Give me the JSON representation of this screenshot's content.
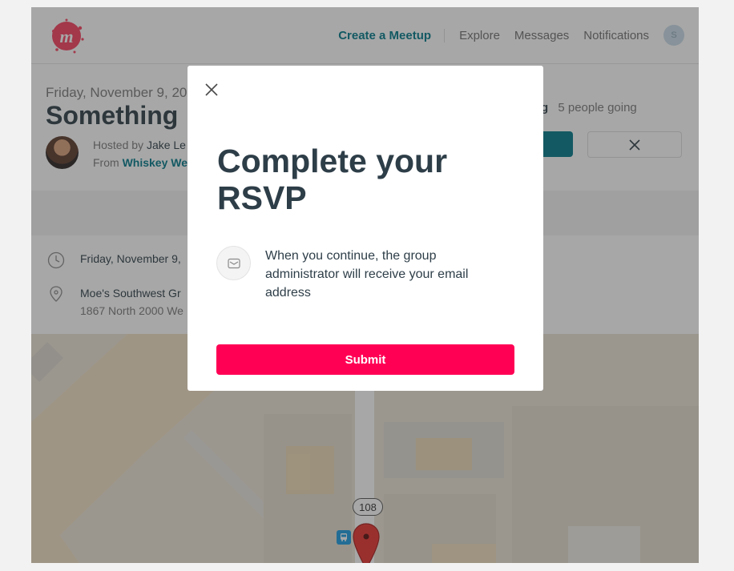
{
  "header": {
    "logo_letter": "m",
    "create_meetup": "Create a Meetup",
    "explore": "Explore",
    "messages": "Messages",
    "notifications": "Notifications",
    "avatar_initial": "S"
  },
  "event": {
    "date": "Friday, November 9, 20",
    "title": "Something",
    "hosted_prefix": "Hosted by",
    "host_name": "Jake Le",
    "from_prefix": "From",
    "group_name": "Whiskey We",
    "going_label": "g",
    "going_count": "5 people going"
  },
  "details": {
    "when": "Friday, November 9,",
    "place": "Moe's Southwest Gr",
    "address": "1867 North 2000 We"
  },
  "map": {
    "route_number": "108"
  },
  "modal": {
    "title": "Complete your RSVP",
    "notice": "When you continue, the group administrator will receive your email address",
    "submit": "Submit"
  },
  "colors": {
    "brand_red": "#f64060",
    "teal": "#00798a",
    "submit_bg": "#ff0055",
    "title_text": "#2e3e48"
  }
}
